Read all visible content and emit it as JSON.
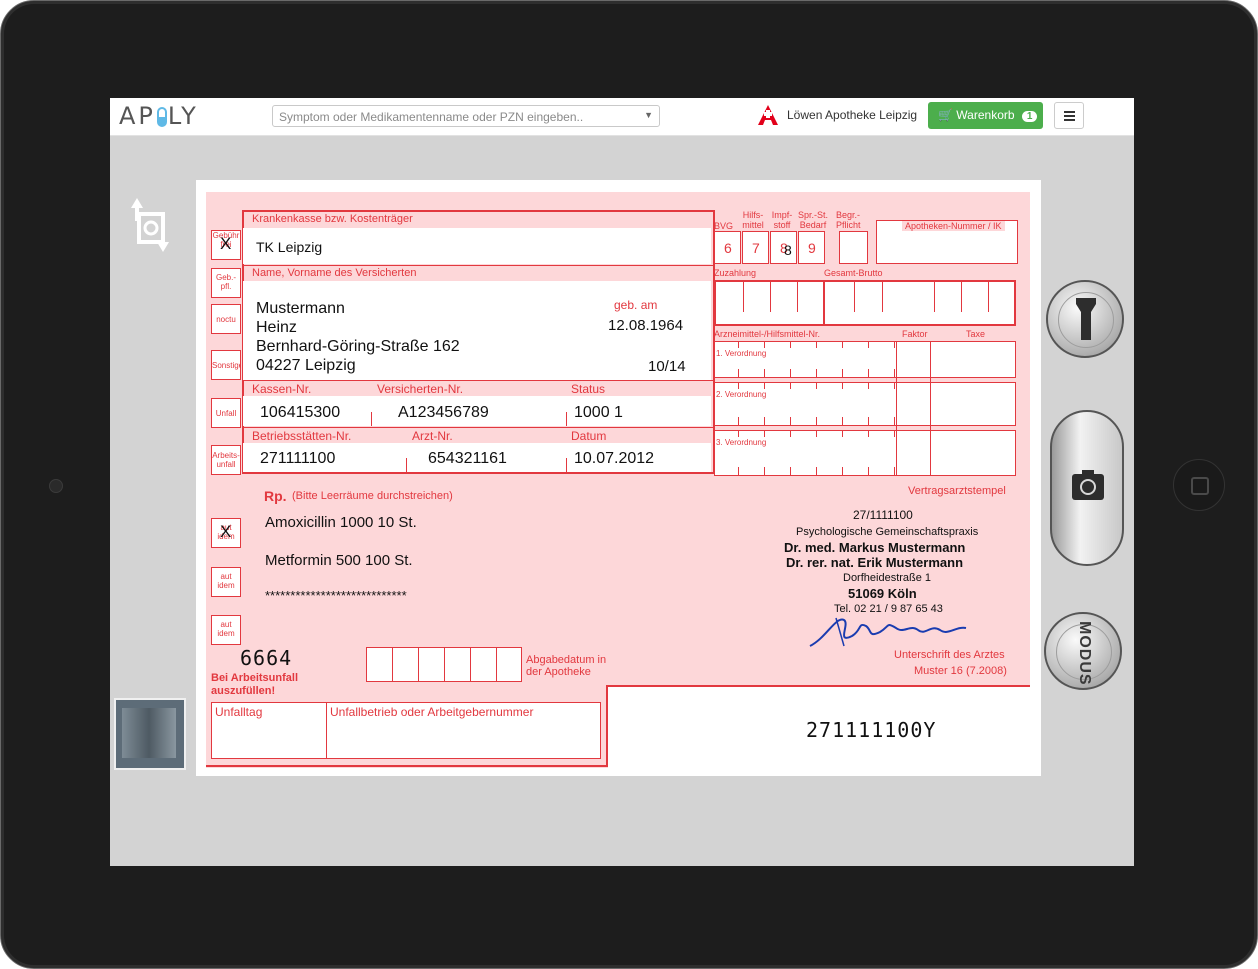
{
  "topbar": {
    "logo": "AP LY",
    "search_placeholder": "Symptom oder Medikamentenname oder PZN eingeben..",
    "pharmacy_icon": "apotheke-a-icon",
    "pharmacy_name": "Löwen Apotheke Leipzig",
    "cart_label": "Warenkorb",
    "cart_count": "1",
    "menu_icon": "hamburger-icon"
  },
  "left_controls": {
    "rotate_icon": "rotate-icon",
    "thumbnail_icon": "prescription-thumbnail"
  },
  "right_controls": {
    "top_icon": "torch-icon",
    "camera_icon": "camera-icon",
    "mode_label": "MODUS"
  },
  "prescription": {
    "side_labels": [
      "Gebühr frei",
      "Geb.-pfl.",
      "noctu",
      "Sonstige",
      "Unfall",
      "Arbeits-unfall"
    ],
    "side_marks": [
      "X"
    ],
    "header_insurer": "Krankenkasse bzw. Kostenträger",
    "insurer": "TK Leipzig",
    "header_name": "Name, Vorname des Versicherten",
    "surname": "Mustermann",
    "firstname": "Heinz",
    "street": "Bernhard-Göring-Straße 162",
    "city": "04227 Leipzig",
    "dob_label": "geb. am",
    "dob": "12.08.1964",
    "valid": "10/14",
    "kassen_label": "Kassen-Nr.",
    "kassen": "106415300",
    "versicherten_label": "Versicherten-Nr.",
    "versicherten": "A123456789",
    "status_label": "Status",
    "status": "1000 1",
    "bs_label": "Betriebsstätten-Nr.",
    "bs": "271111100",
    "arzt_label": "Arzt-Nr.",
    "arzt": "654321161",
    "datum_label": "Datum",
    "datum": "10.07.2012",
    "rp": "Rp.",
    "rp_hint": "(Bitte Leerräume durchstreichen)",
    "aut_idem": "aut idem",
    "med1": "Amoxicillin 1000 10 St.",
    "med2": "Metformin 500 100 St.",
    "stars": "****************************",
    "handwritten_code": "6664",
    "unfall_hint": "Bei Arbeitsunfall auszufüllen!",
    "unfalltag": "Unfalltag",
    "unfallbetrieb": "Unfallbetrieb oder Arbeitgebernummer",
    "abgabe": "Abgabedatum in der Apotheke",
    "top_labels": {
      "bvg": "BVG",
      "hilfsmittel": "Hilfs- mittel",
      "impfstoff": "Impf- stoff",
      "spr": "Spr.-St. Bedarf",
      "begr": "Begr.- Pflicht",
      "apotheken": "Apotheken-Nummer / IK"
    },
    "num_boxes": [
      "6",
      "7",
      "8",
      "9"
    ],
    "num_overlay": "8",
    "zuzahlung": "Zuzahlung",
    "gesamt": "Gesamt-Brutto",
    "arznei": "Arzneimittel-/Hilfsmittel-Nr.",
    "faktor": "Faktor",
    "taxe": "Taxe",
    "v1": "1. Verordnung",
    "v2": "2. Verordnung",
    "v3": "3. Verordnung",
    "stempel_label": "Vertragsarztstempel",
    "stamp_num": "27/1111100",
    "stamp_practice": "Psychologische Gemeinschaftspraxis",
    "doc1": "Dr. med. Markus Mustermann",
    "doc2": "Dr. rer. nat. Erik Mustermann",
    "street2": "Dorfheidestraße 1",
    "city2": "51069 Köln",
    "tel": "Tel. 02 21 / 9 87 65 43",
    "signature_label": "Unterschrift des Arztes",
    "muster": "Muster 16 (7.2008)",
    "bottom_code": "271111100Y"
  }
}
